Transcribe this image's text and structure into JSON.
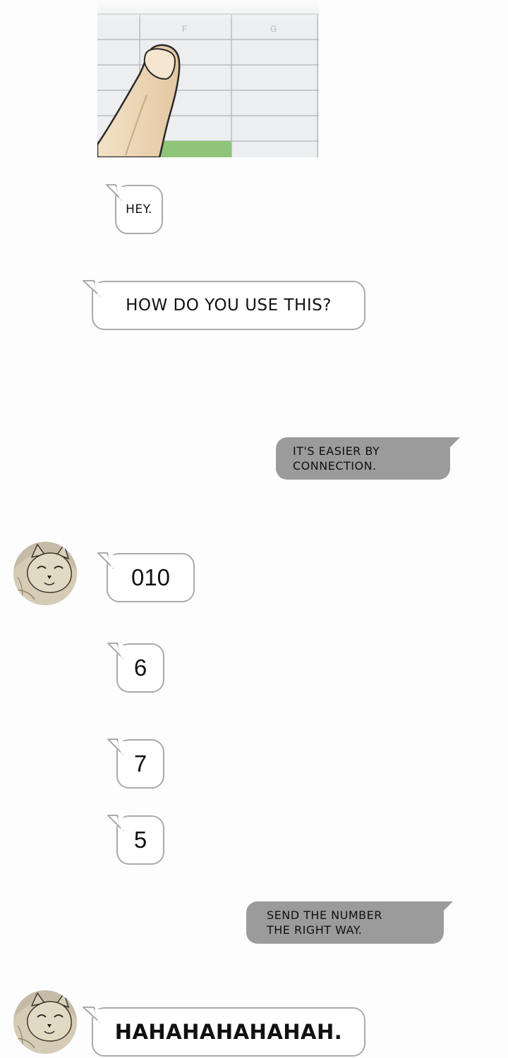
{
  "colors": {
    "incoming_bubble": "#ffffff",
    "incoming_border": "#aaaaaa",
    "outgoing_bubble": "#9b9b9b",
    "page_background": "#fdfdfd",
    "spreadsheet_highlight": "#8fc47a"
  },
  "panel": {
    "spreadsheet_columns": [
      "F",
      "G"
    ],
    "icon": "finger-pointing-at-spreadsheet"
  },
  "messages": [
    {
      "from": "other",
      "text": "HEY."
    },
    {
      "from": "other",
      "text": "HOW DO YOU USE THIS?"
    },
    {
      "from": "me",
      "line1": "IT'S EASIER BY",
      "line2": "CONNECTION."
    },
    {
      "from": "other",
      "text": "010"
    },
    {
      "from": "other",
      "text": "6"
    },
    {
      "from": "other",
      "text": "7"
    },
    {
      "from": "other",
      "text": "5"
    },
    {
      "from": "me",
      "line1": "SEND THE NUMBER",
      "line2": "THE RIGHT WAY."
    },
    {
      "from": "other",
      "text": "HAHAHAHAHAHAH."
    }
  ],
  "avatar": {
    "icon": "cat-avatar-icon"
  }
}
